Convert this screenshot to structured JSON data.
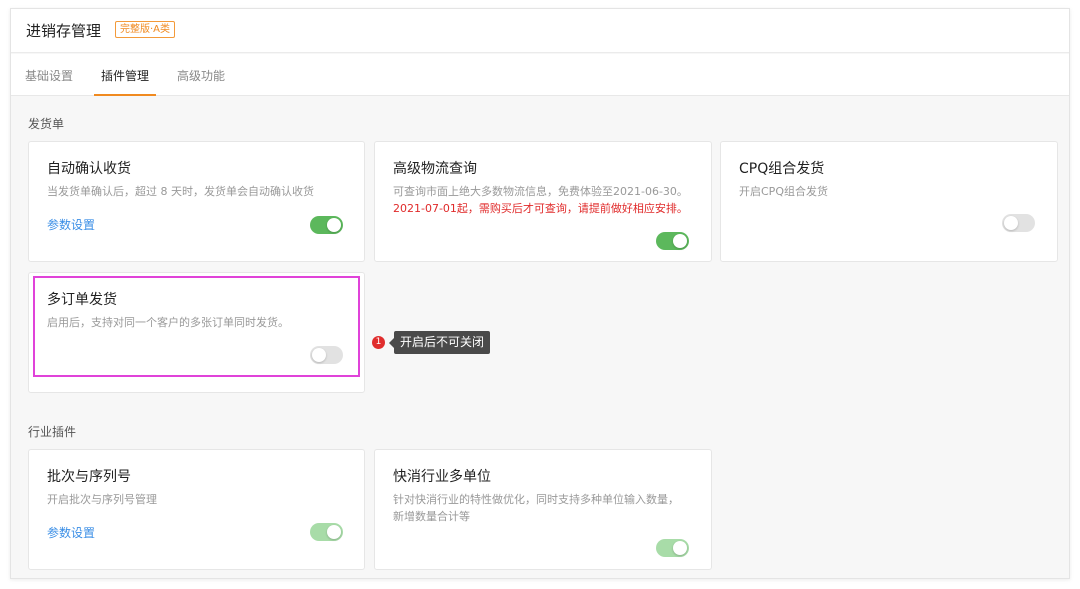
{
  "header": {
    "title": "进销存管理",
    "badge": "完整版·A类"
  },
  "tabs": [
    {
      "label": "基础设置",
      "active": false
    },
    {
      "label": "插件管理",
      "active": true
    },
    {
      "label": "高级功能",
      "active": false
    }
  ],
  "sections": [
    {
      "title": "发货单",
      "cards": [
        {
          "title": "自动确认收货",
          "desc": "当发货单确认后，超过 8 天时，发货单会自动确认收货",
          "link": "参数设置",
          "toggle": "on"
        },
        {
          "title": "高级物流查询",
          "desc": "可查询市面上绝大多数物流信息，免费体验至2021-06-30。",
          "warning": "2021-07-01起，需购买后才可查询，请提前做好相应安排。",
          "toggle": "on"
        },
        {
          "title": "CPQ组合发货",
          "desc": "开启CPQ组合发货",
          "toggle": "off"
        },
        {
          "title": "多订单发货",
          "desc": "启用后，支持对同一个客户的多张订单同时发货。",
          "toggle": "off"
        }
      ]
    },
    {
      "title": "行业插件",
      "cards": [
        {
          "title": "批次与序列号",
          "desc": "开启批次与序列号管理",
          "link": "参数设置",
          "toggle": "on-disabled"
        },
        {
          "title": "快消行业多单位",
          "desc": "针对快消行业的特性做优化，同时支持多种单位输入数量，",
          "desc2": "新增数量合计等",
          "toggle": "on-disabled"
        }
      ]
    }
  ],
  "annotation": {
    "step": "1",
    "tooltip": "开启后不可关闭"
  },
  "colors": {
    "accent": "#f08a20",
    "toggle_on": "#5cb85c",
    "link": "#3a8ee6",
    "warning": "#e02a2a",
    "highlight": "#e043d9"
  }
}
